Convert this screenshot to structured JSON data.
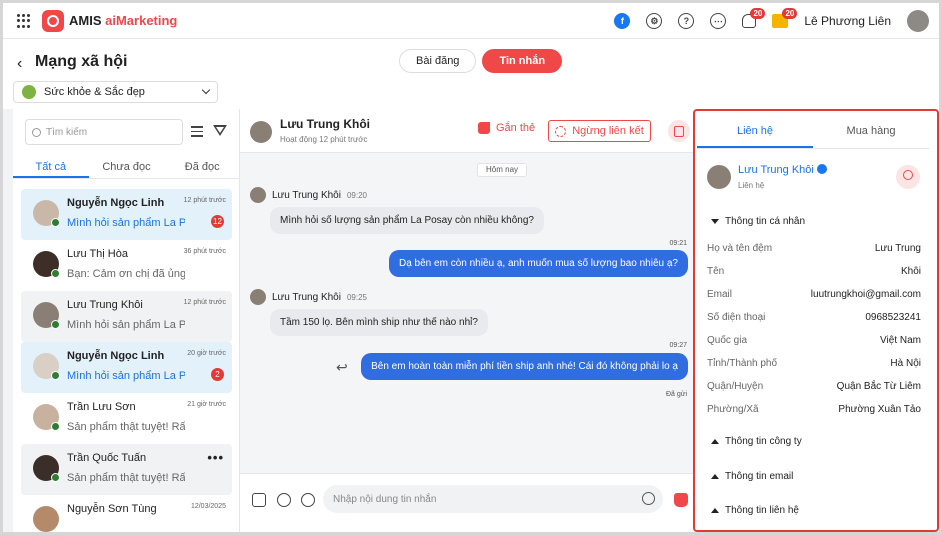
{
  "app": {
    "brand": "AMIS ",
    "brand_ai": "aiMarketing",
    "user_name": "Lê Phương Liên",
    "notif_badge": "20",
    "gift_badge": "20"
  },
  "header": {
    "page_title": "Mạng xã hội",
    "tabs": [
      "Bài đăng",
      "Tin nhắn"
    ],
    "page_select": "Sức khỏe & Sắc đẹp"
  },
  "inbox": {
    "search_placeholder": "Tìm kiếm",
    "tabs": [
      "Tất cả",
      "Chưa đọc",
      "Đã đọc"
    ],
    "conversations": [
      {
        "name": "Nguyễn Ngọc Linh",
        "msg": "Mình hỏi sản phẩm La Posay",
        "time": "12 phút trước",
        "badge": "12"
      },
      {
        "name": "Lưu Thị Hòa",
        "msg": "Bạn: Cảm ơn chị đã ủng hộ",
        "time": "36 phút trước",
        "badge": ""
      },
      {
        "name": "Lưu Trung Khôi",
        "msg": "Mình hỏi sản phẩm La Posay",
        "time": "12 phút trước",
        "badge": ""
      },
      {
        "name": "Nguyễn Ngọc Linh",
        "msg": "Mình hỏi sản phẩm La Posay",
        "time": "20 giờ trước",
        "badge": "2"
      },
      {
        "name": "Trần Lưu Sơn",
        "msg": "Sản phẩm thật tuyệt! Rất cảm ơn",
        "time": "21 giờ trước",
        "badge": ""
      },
      {
        "name": "Trần Quốc Tuấn",
        "msg": "Sản phẩm thật tuyệt! Rất cảm ơn",
        "time": "",
        "badge": ""
      },
      {
        "name": "Nguyễn Sơn Tùng",
        "msg": "",
        "time": "12/03/2025",
        "badge": ""
      }
    ]
  },
  "chat": {
    "contact_name": "Lưu Trung Khôi",
    "status": "Hoạt động 12 phút trước",
    "tag_label": "Gắn thẻ",
    "unlink_label": "Ngừng liên kết",
    "date_divider": "Hôm nay",
    "messages": [
      {
        "dir": "in",
        "sender": "Lưu Trung Khôi",
        "time": "09:20",
        "text": "Mình hỏi số lượng sản phẩm La Posay còn nhiều không?"
      },
      {
        "dir": "out",
        "time": "09:21",
        "text": "Dạ bên em còn nhiều ạ, anh muốn mua số lượng bao nhiêu ạ?"
      },
      {
        "dir": "in",
        "sender": "Lưu Trung Khôi",
        "time": "09:25",
        "text": "Tầm 150 lọ. Bên mình ship như thế nào nhỉ?"
      },
      {
        "dir": "out",
        "time": "09:27",
        "text": "Bên em hoàn toàn miễn phí tiền ship anh nhé! Cái đó không phải lo ạ"
      }
    ],
    "sent_status": "Đã gửi",
    "input_placeholder": "Nhập nội dung tin nhắn"
  },
  "profile": {
    "tabs": [
      "Liên hệ",
      "Mua hàng"
    ],
    "name": "Lưu Trung Khôi",
    "subtitle": "Liên hệ",
    "section_personal": "Thông tin cá nhân",
    "fields": [
      {
        "label": "Họ và tên đệm",
        "value": "Lưu Trung"
      },
      {
        "label": "Tên",
        "value": "Khôi"
      },
      {
        "label": "Email",
        "value": "luutrungkhoi@gmail.com"
      },
      {
        "label": "Số điện thoại",
        "value": "0968523241"
      },
      {
        "label": "Quốc gia",
        "value": "Việt Nam"
      },
      {
        "label": "Tỉnh/Thành phố",
        "value": "Hà Nội"
      },
      {
        "label": "Quận/Huyện",
        "value": "Quận Bắc Từ Liêm"
      },
      {
        "label": "Phường/Xã",
        "value": "Phường Xuân Tảo"
      }
    ],
    "section_company": "Thông tin công ty",
    "section_email": "Thông tin email",
    "section_contact": "Thông tin liên hệ"
  }
}
